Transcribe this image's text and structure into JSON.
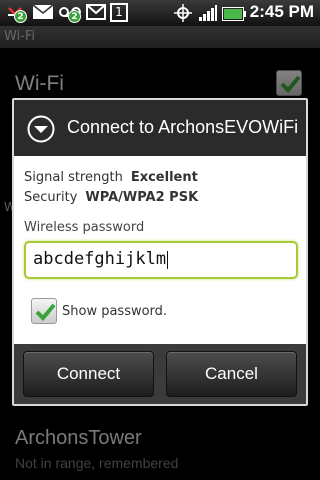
{
  "status_bar": {
    "time": "2:45 PM",
    "notif_badge_1": "2",
    "notif_badge_2": "2",
    "calendar_day": "1",
    "icons": [
      "missed-call-icon",
      "email-icon",
      "voicemail-icon",
      "gmail-icon",
      "calendar-icon",
      "gps-icon",
      "signal-icon",
      "battery-icon"
    ]
  },
  "background": {
    "header_title": "Wi-Fi",
    "wifi_label": "Wi-Fi",
    "wifi_enabled": true,
    "side_letter": "W",
    "network": {
      "name": "ArchonsTower",
      "status": "Not in range, remembered"
    }
  },
  "dialog": {
    "title": "Connect to ArchonsEVOWiFi",
    "signal_label": "Signal strength",
    "signal_value": "Excellent",
    "security_label": "Security",
    "security_value": "WPA/WPA2 PSK",
    "password_label": "Wireless password",
    "password_value": "abcdefghijklm",
    "show_password_label": "Show password.",
    "show_password_checked": true,
    "connect_label": "Connect",
    "cancel_label": "Cancel"
  },
  "colors": {
    "accent_green": "#a9c93a",
    "check_green": "#3aa33a",
    "title_bar": "#2b2b2b"
  }
}
